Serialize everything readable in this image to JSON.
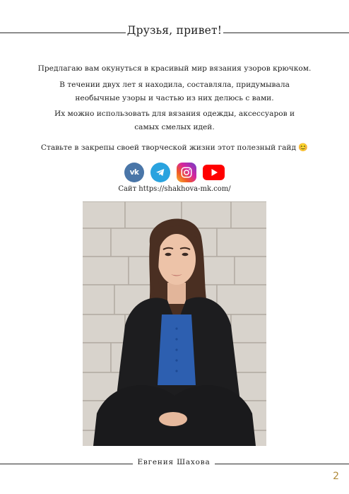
{
  "header": {
    "title": "Друзья, привет!"
  },
  "intro": {
    "p1": "Предлагаю вам окунуться в красивый мир вязания узоров крючком.",
    "p2_l1": "В течении двух лет я находила, составляла, придумывала",
    "p2_l2": "необычные узоры и частью из них делюсь с вами.",
    "p3_l1": "Их можно использовать для вязания одежды, аксессуаров и",
    "p3_l2": "самых смелых идей.",
    "p4": "Ставьте в закрепы своей творческой жизни этот полезный гайд",
    "p4_emoji": "😊"
  },
  "socials": {
    "vk_label": "vk",
    "icons": [
      "vk-icon",
      "telegram-icon",
      "instagram-icon",
      "youtube-icon"
    ],
    "colors": {
      "vk": "#4a76a8",
      "telegram": "#2aa3df",
      "youtube": "#ff0000"
    }
  },
  "site": {
    "label": "Сайт https://shakhova-mk.com/"
  },
  "footer": {
    "author": "Евгения Шахова"
  },
  "page": {
    "number": "2"
  }
}
